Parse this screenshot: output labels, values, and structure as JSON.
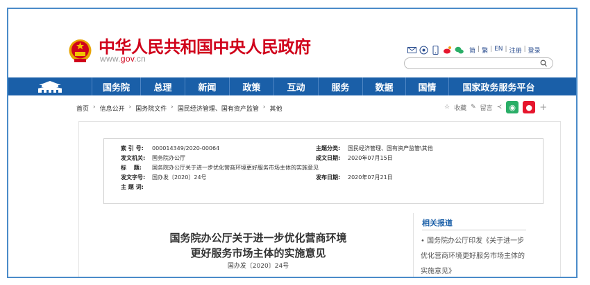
{
  "header": {
    "site_title": "中华人民共和国中央人民政府",
    "site_url_prefix": "www.",
    "site_url_domain": "gov",
    "site_url_suffix": ".cn",
    "top_links": [
      "简",
      "繁",
      "EN",
      "注册",
      "登录"
    ],
    "top_icons": [
      "mail-icon",
      "wechat-circle-icon",
      "mobile-icon",
      "weibo-icon",
      "wechat-icon"
    ],
    "search_placeholder": ""
  },
  "nav": {
    "items": [
      "国务院",
      "总理",
      "新闻",
      "政策",
      "互动",
      "服务",
      "数据",
      "国情",
      "国家政务服务平台"
    ]
  },
  "breadcrumb": [
    "首页",
    "信息公开",
    "国务院文件",
    "国民经济管理、国有资产监管",
    "其他"
  ],
  "share": {
    "favorite": "收藏",
    "comment": "留言"
  },
  "meta": {
    "index_label": "索 引 号:",
    "index_value": "000014349/2020-00064",
    "category_label": "主题分类:",
    "category_value": "国民经济管理、国有资产监管\\其他",
    "issuer_label": "发文机关:",
    "issuer_value": "国务院办公厅",
    "date_written_label": "成文日期:",
    "date_written_value": "2020年07月15日",
    "title_label": "标　 题:",
    "title_value": "国务院办公厅关于进一步优化营商环境更好服务市场主体的实施意见",
    "docno_label": "发文字号:",
    "docno_value": "国办发〔2020〕24号",
    "pub_date_label": "发布日期:",
    "pub_date_value": "2020年07月21日",
    "keywords_label": "主 题 词:",
    "keywords_value": ""
  },
  "document": {
    "title_line1": "国务院办公厅关于进一步优化营商环境",
    "title_line2": "更好服务市场主体的实施意见",
    "number": "国办发〔2020〕24号"
  },
  "related": {
    "title": "相关报道",
    "item": "• 国务院办公厅印发《关于进一步优化营商环境更好服务市场主体的实施意见》"
  },
  "colors": {
    "brand_red": "#d0021b",
    "nav_blue": "#1a5fa8",
    "frame_blue": "#4a8bc9"
  }
}
